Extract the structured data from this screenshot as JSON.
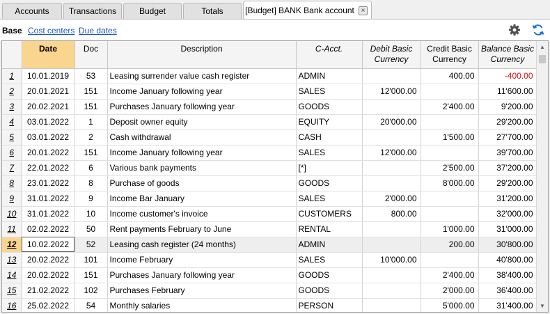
{
  "tabs": [
    {
      "label": "Accounts"
    },
    {
      "label": "Transactions"
    },
    {
      "label": "Budget"
    },
    {
      "label": "Totals"
    },
    {
      "label": "[Budget] BANK Bank account"
    }
  ],
  "close_glyph": "×",
  "views": {
    "base": "Base",
    "cost_centers": "Cost centers",
    "due_dates": "Due dates"
  },
  "icons": {
    "settings": "gear-icon",
    "refresh": "refresh-icon",
    "refresh_color": "#1a73d9"
  },
  "columns": {
    "date": "Date",
    "doc": "Doc",
    "description": "Description",
    "cacct": "C-Acct.",
    "debit": "Debit Basic Currency",
    "credit": "Credit Basic Currency",
    "balance": "Balance Basic Currency"
  },
  "rows": [
    {
      "n": "1",
      "date": "10.01.2019",
      "doc": "53",
      "desc": "Leasing surrender value cash register",
      "cacct": "ADMIN",
      "debit": "",
      "credit": "400.00",
      "balance": "-400.00"
    },
    {
      "n": "2",
      "date": "20.01.2021",
      "doc": "151",
      "desc": "Income January following year",
      "cacct": "SALES",
      "debit": "12'000.00",
      "credit": "",
      "balance": "11'600.00"
    },
    {
      "n": "3",
      "date": "20.02.2021",
      "doc": "151",
      "desc": "Purchases January following year",
      "cacct": "GOODS",
      "debit": "",
      "credit": "2'400.00",
      "balance": "9'200.00"
    },
    {
      "n": "4",
      "date": "03.01.2022",
      "doc": "1",
      "desc": "Deposit owner equity",
      "cacct": "EQUITY",
      "debit": "20'000.00",
      "credit": "",
      "balance": "29'200.00"
    },
    {
      "n": "5",
      "date": "03.01.2022",
      "doc": "2",
      "desc": "Cash withdrawal",
      "cacct": "CASH",
      "debit": "",
      "credit": "1'500.00",
      "balance": "27'700.00"
    },
    {
      "n": "6",
      "date": "20.01.2022",
      "doc": "151",
      "desc": "Income January following year",
      "cacct": "SALES",
      "debit": "12'000.00",
      "credit": "",
      "balance": "39'700.00"
    },
    {
      "n": "7",
      "date": "22.01.2022",
      "doc": "6",
      "desc": "Various bank payments",
      "cacct": "[*]",
      "debit": "",
      "credit": "2'500.00",
      "balance": "37'200.00"
    },
    {
      "n": "8",
      "date": "23.01.2022",
      "doc": "8",
      "desc": "Purchase of goods",
      "cacct": "GOODS",
      "debit": "",
      "credit": "8'000.00",
      "balance": "29'200.00"
    },
    {
      "n": "9",
      "date": "31.01.2022",
      "doc": "9",
      "desc": "Income Bar January",
      "cacct": "SALES",
      "debit": "2'000.00",
      "credit": "",
      "balance": "31'200.00"
    },
    {
      "n": "10",
      "date": "31.01.2022",
      "doc": "10",
      "desc": "Income customer's invoice",
      "cacct": "CUSTOMERS",
      "debit": "800.00",
      "credit": "",
      "balance": "32'000.00"
    },
    {
      "n": "11",
      "date": "02.02.2022",
      "doc": "50",
      "desc": "Rent payments February to June",
      "cacct": "RENTAL",
      "debit": "",
      "credit": "1'000.00",
      "balance": "31'000.00"
    },
    {
      "n": "12",
      "date": "10.02.2022",
      "doc": "52",
      "desc": "Leasing cash register (24 months)",
      "cacct": "ADMIN",
      "debit": "",
      "credit": "200.00",
      "balance": "30'800.00"
    },
    {
      "n": "13",
      "date": "20.02.2022",
      "doc": "101",
      "desc": "Income February",
      "cacct": "SALES",
      "debit": "10'000.00",
      "credit": "",
      "balance": "40'800.00"
    },
    {
      "n": "14",
      "date": "20.02.2022",
      "doc": "151",
      "desc": "Purchases January following year",
      "cacct": "GOODS",
      "debit": "",
      "credit": "2'400.00",
      "balance": "38'400.00"
    },
    {
      "n": "15",
      "date": "21.02.2022",
      "doc": "102",
      "desc": "Purchases February",
      "cacct": "GOODS",
      "debit": "",
      "credit": "2'000.00",
      "balance": "36'400.00"
    },
    {
      "n": "16",
      "date": "25.02.2022",
      "doc": "54",
      "desc": "Monthly salaries",
      "cacct": "PERSON",
      "debit": "",
      "credit": "5'000.00",
      "balance": "31'400.00"
    }
  ],
  "selected_row": "12",
  "colors": {
    "active_column": "#fad58f",
    "negative": "#e01010",
    "link": "#1a56c2"
  }
}
